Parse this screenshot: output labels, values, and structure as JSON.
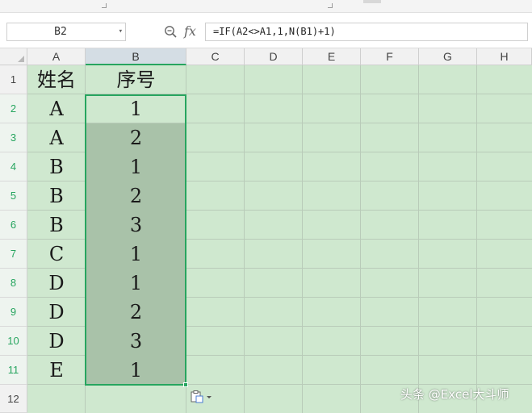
{
  "formula_bar": {
    "name_box": "B2",
    "fx_label": "fx",
    "formula": "=IF(A2<>A1,1,N(B1)+1)"
  },
  "columns": [
    "A",
    "B",
    "C",
    "D",
    "E",
    "F",
    "G",
    "H"
  ],
  "rows": [
    "1",
    "2",
    "3",
    "4",
    "5",
    "6",
    "7",
    "8",
    "9",
    "10",
    "11",
    "12"
  ],
  "cells": {
    "header": {
      "name": "姓名",
      "seq": "序号"
    },
    "data": [
      {
        "name": "A",
        "seq": "1"
      },
      {
        "name": "A",
        "seq": "2"
      },
      {
        "name": "B",
        "seq": "1"
      },
      {
        "name": "B",
        "seq": "2"
      },
      {
        "name": "B",
        "seq": "3"
      },
      {
        "name": "C",
        "seq": "1"
      },
      {
        "name": "D",
        "seq": "1"
      },
      {
        "name": "D",
        "seq": "2"
      },
      {
        "name": "D",
        "seq": "3"
      },
      {
        "name": "E",
        "seq": "1"
      }
    ]
  },
  "watermark": "头条 @Excel大斗师",
  "colors": {
    "grid_bg": "#cfe8cf",
    "selection_border": "#27a55f",
    "selection_fill": "#a9c2a9"
  }
}
